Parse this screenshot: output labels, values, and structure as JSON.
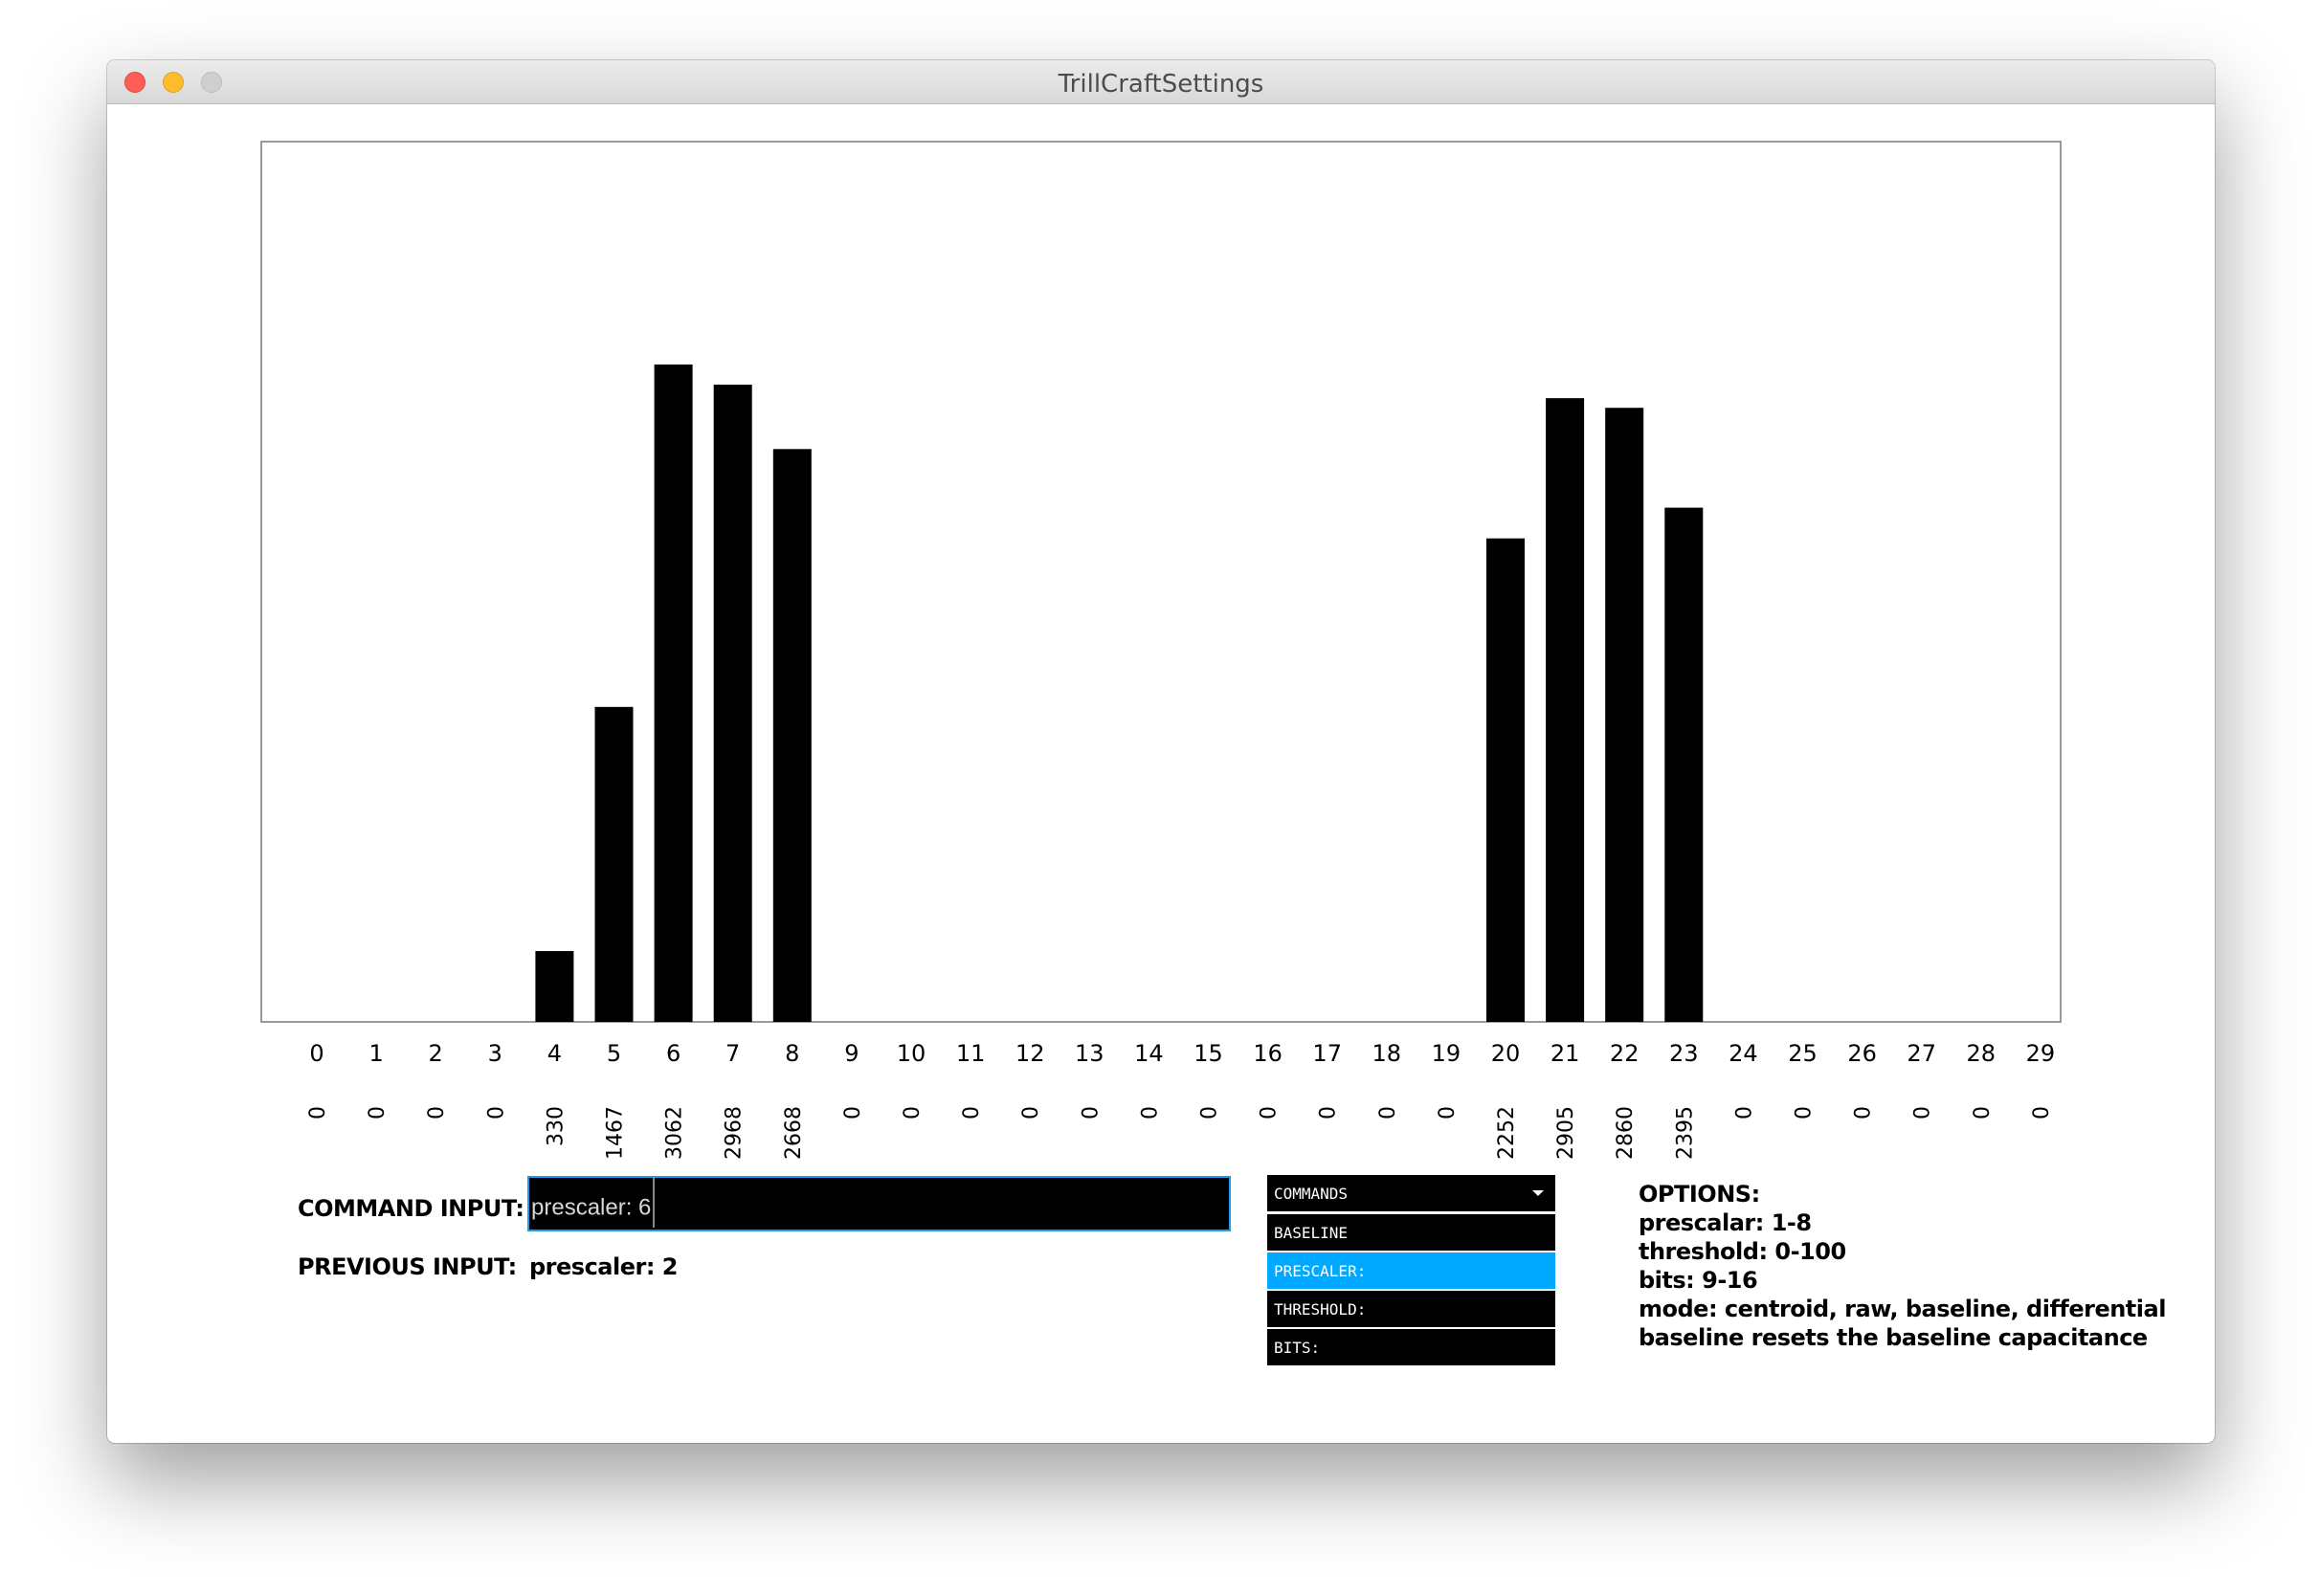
{
  "window": {
    "title": "TrillCraftSettings"
  },
  "chart_data": {
    "type": "bar",
    "categories": [
      "0",
      "1",
      "2",
      "3",
      "4",
      "5",
      "6",
      "7",
      "8",
      "9",
      "10",
      "11",
      "12",
      "13",
      "14",
      "15",
      "16",
      "17",
      "18",
      "19",
      "20",
      "21",
      "22",
      "23",
      "24",
      "25",
      "26",
      "27",
      "28",
      "29"
    ],
    "values": [
      0,
      0,
      0,
      0,
      330,
      1467,
      3062,
      2968,
      2668,
      0,
      0,
      0,
      0,
      0,
      0,
      0,
      0,
      0,
      0,
      0,
      2252,
      2905,
      2860,
      2395,
      0,
      0,
      0,
      0,
      0,
      0
    ],
    "ylim": [
      0,
      4100
    ],
    "grid": false
  },
  "controls": {
    "command_label": "COMMAND INPUT:",
    "command_value": "prescaler: 6",
    "previous_label": "PREVIOUS INPUT:",
    "previous_value": "prescaler: 2"
  },
  "dropdown": {
    "title": "COMMANDS",
    "items": [
      "BASELINE",
      "PRESCALER:",
      "THRESHOLD:",
      "BITS:"
    ],
    "selected": "PRESCALER:"
  },
  "options": {
    "heading": "OPTIONS:",
    "lines": [
      "prescalar: 1-8",
      "threshold: 0-100",
      "bits: 9-16",
      "mode: centroid, raw, baseline, differential",
      "baseline resets the baseline capacitance"
    ]
  }
}
